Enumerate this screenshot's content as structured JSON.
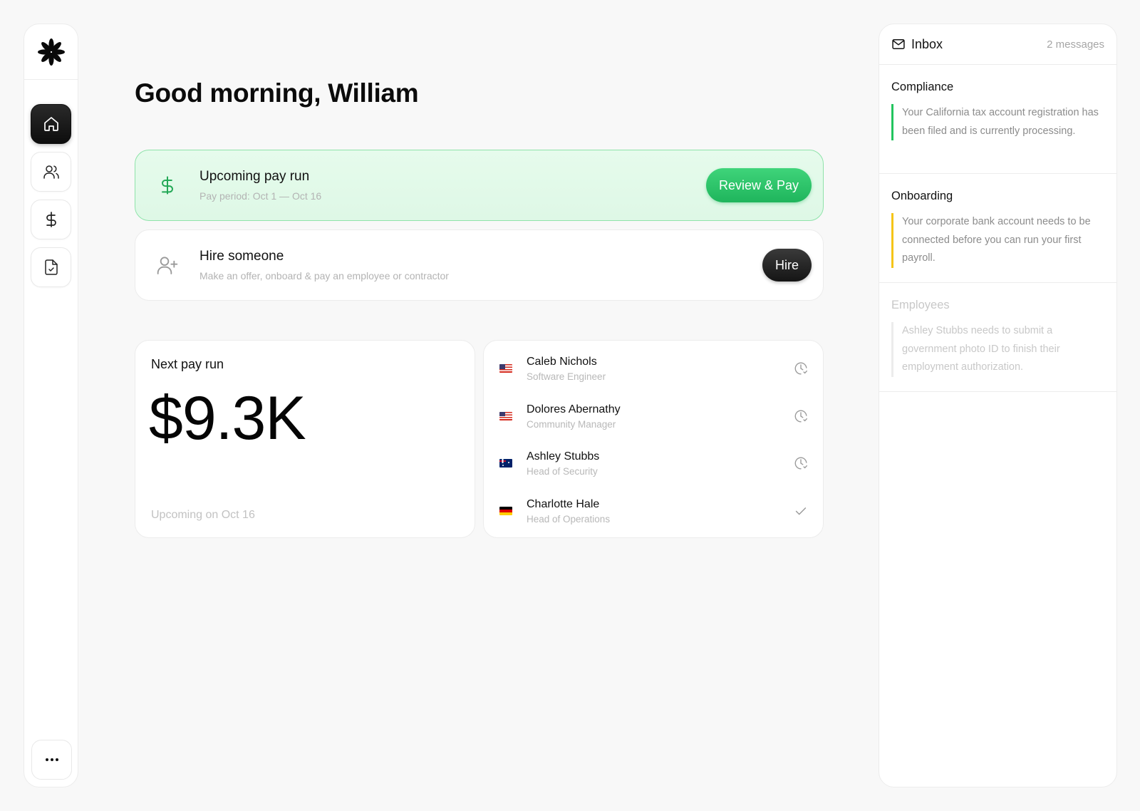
{
  "app": {
    "logo": "asterisk-logo"
  },
  "sidebar": {
    "items": [
      {
        "name": "home",
        "icon": "home-icon",
        "active": true
      },
      {
        "name": "people",
        "icon": "users-icon",
        "active": false
      },
      {
        "name": "payments",
        "icon": "dollar-icon",
        "active": false
      },
      {
        "name": "documents",
        "icon": "file-check-icon",
        "active": false
      }
    ],
    "more_icon": "more-horizontal-icon"
  },
  "main": {
    "greeting": "Good morning, William",
    "pay_run_card": {
      "title": "Upcoming pay run",
      "subtitle": "Pay period: Oct 1 — Oct 16",
      "button": "Review & Pay",
      "icon": "dollar-icon"
    },
    "hire_card": {
      "title": "Hire someone",
      "subtitle": "Make an offer, onboard & pay an employee or contractor",
      "button": "Hire",
      "icon": "user-plus-icon"
    },
    "next_pay_run": {
      "label": "Next pay run",
      "amount": "$9.3K",
      "upcoming": "Upcoming on Oct 16"
    },
    "employees": [
      {
        "name": "Caleb Nichols",
        "role": "Software Engineer",
        "flag": "us",
        "status": "pending"
      },
      {
        "name": "Dolores Abernathy",
        "role": "Community Manager",
        "flag": "us",
        "status": "pending"
      },
      {
        "name": "Ashley Stubbs",
        "role": "Head of Security",
        "flag": "au",
        "status": "pending"
      },
      {
        "name": "Charlotte Hale",
        "role": "Head of Operations",
        "flag": "de",
        "status": "done"
      }
    ]
  },
  "inbox": {
    "title": "Inbox",
    "count": "2 messages",
    "messages": [
      {
        "category": "Compliance",
        "body": "Your California tax account registration has been filed and is currently processing.",
        "accent": "#22c55e"
      },
      {
        "category": "Onboarding",
        "body": "Your corporate bank account needs to be connected before you can run your first payroll.",
        "accent": "#f5c518"
      },
      {
        "category": "Employees",
        "body": "Ashley Stubbs needs to submit a government photo ID to finish their employment authorization.",
        "accent": "#ececec"
      }
    ]
  },
  "colors": {
    "accent_green": "#22c55e",
    "accent_yellow": "#f5c518",
    "background": "#f8f8f8"
  }
}
